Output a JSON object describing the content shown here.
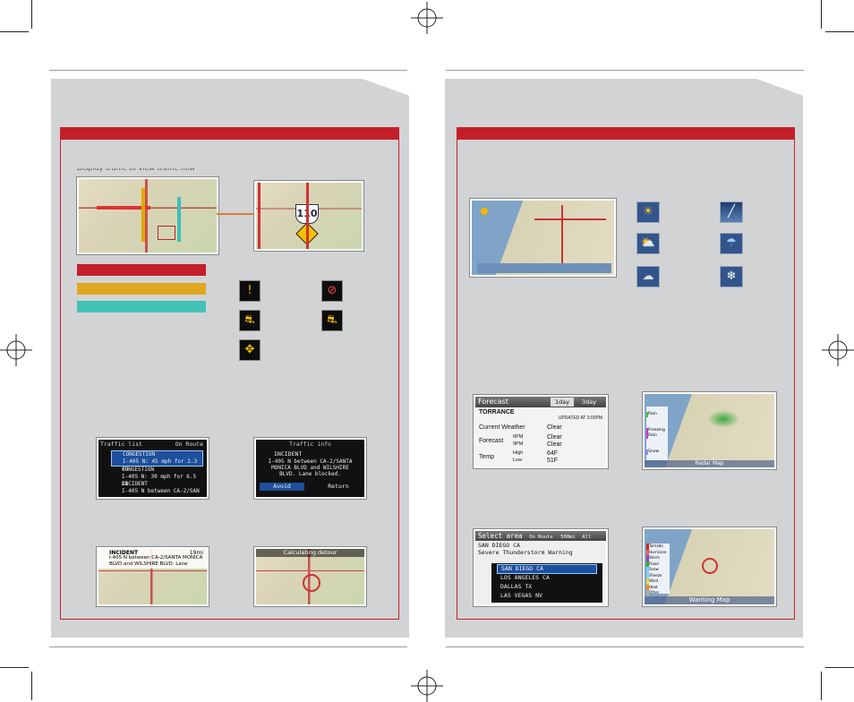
{
  "left_page": {
    "subtitle_partial": "Display traffic to view traffic flow",
    "traffic_list": {
      "title": "Traffic list",
      "scope": "On Route",
      "rows": [
        {
          "kind": "CONGESTION",
          "dist": "13mi",
          "desc": "I-405 N: 45 mph for 2.3 mi"
        },
        {
          "kind": "CONGESTION",
          "dist": "15mi",
          "desc": "I-405 N: 30 mph for 6.5 mi"
        },
        {
          "kind": "INCIDENT",
          "dist": "19mi",
          "desc": "I-405 N between CA-2/SAN"
        }
      ]
    },
    "traffic_info": {
      "title": "Traffic info",
      "heading": "INCIDENT",
      "body": "I-405 N between CA-2/SANTA MONICA BLVD and WILSHIRE BLVD. Lane blocked.",
      "avoid": "Avoid",
      "return": "Return"
    },
    "incident_map": {
      "heading": "INCIDENT",
      "dist": "19mi",
      "body": "I-405 N between CA-2/SANTA MONICA BLVD and WILSHIRE BLVD. Lane"
    },
    "calculating": "Calculating detour",
    "zoom_shield": "110"
  },
  "right_page": {
    "forecast": {
      "title": "Forecast",
      "tab_1day": "1day",
      "tab_3day": "3day",
      "city": "TORRANCE",
      "updated": "UPDATED AT 3:00PM",
      "current_label": "Current Weather",
      "current_value": "Clear",
      "forecast_label": "Forecast",
      "f1_time": "6PM",
      "f1_value": "Clear",
      "f2_time": "9PM",
      "f2_value": "Clear",
      "temp_label": "Temp",
      "high_label": "High",
      "high_value": "64F",
      "low_label": "Low",
      "low_value": "51F"
    },
    "radar": {
      "legend": [
        "Rain",
        "Freezing Rain",
        "Snow"
      ],
      "title": "Radar Map"
    },
    "select_area": {
      "title": "Select area",
      "scope": "On Route",
      "range": "500mi",
      "all": "All",
      "line1": "SAN DIEGO CA",
      "line2": "Severe Thunderstorm Warning",
      "items": [
        "SAN DIEGO CA",
        "LOS ANGELES CA",
        "DALLAS TX",
        "LAS VEGAS NV"
      ]
    },
    "warning_map": {
      "legend": [
        "Tornado",
        "Hurricane",
        "Storm",
        "Flood",
        "Snow /Freeze",
        "Wind",
        "Heat",
        "Other"
      ],
      "title": "Warning Map"
    }
  }
}
